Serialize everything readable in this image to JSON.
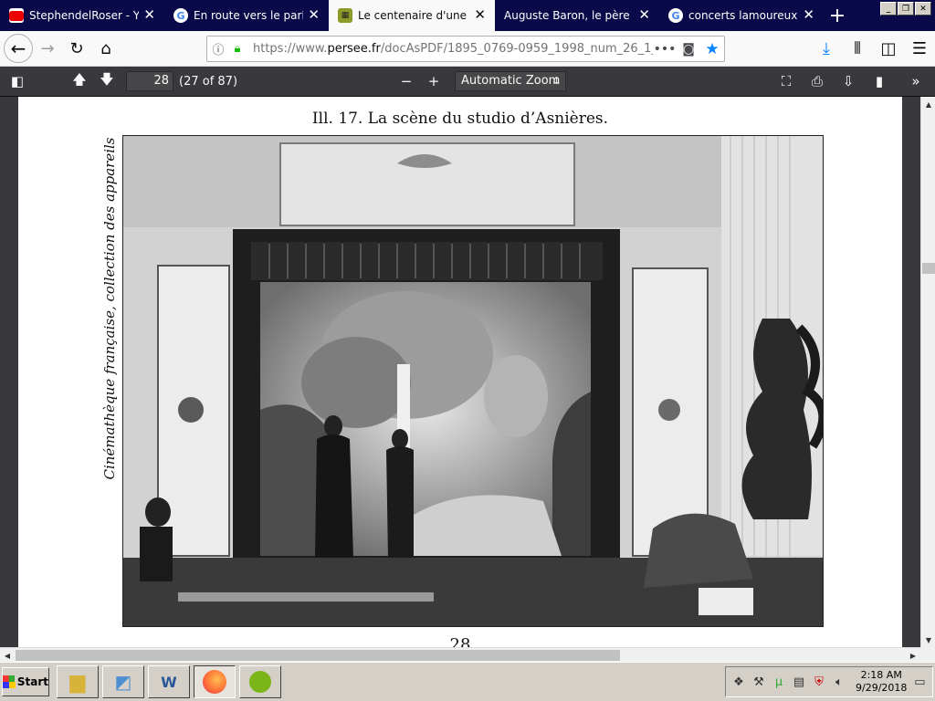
{
  "tabs": [
    {
      "label": "StephendelRoser - YouTu",
      "favicon": "youtube-icon",
      "active": false
    },
    {
      "label": "En route vers le parlant:",
      "favicon": "google-icon",
      "active": false
    },
    {
      "label": "Le centenaire d'une renc",
      "favicon": "persee-icon",
      "active": true
    },
    {
      "label": "Auguste Baron, le père du cin",
      "favicon": "",
      "active": false
    },
    {
      "label": "concerts lamoureux - Re",
      "favicon": "google-icon",
      "active": false
    }
  ],
  "tab_close_glyph": "✕",
  "new_tab_glyph": "+",
  "nav": {
    "url_prefix": "https://www.",
    "url_domain": "persee.fr",
    "url_path": "/docAsPDF/1895_0769-0959_1998_num_26_1_"
  },
  "pdf": {
    "page_number": "28",
    "page_count": "(27 of 87)",
    "zoom": "Automatic Zoom"
  },
  "document": {
    "caption": "Ill. 17. La scène du studio d’Asnières.",
    "side_credit": "Cinémathèque française, collection des appareils",
    "page_footer": "28"
  },
  "taskbar": {
    "start_label": "Start",
    "time": "2:18 AM",
    "date": "9/29/2018"
  },
  "colors": {
    "tab_strip": "#0a0a4a",
    "active_tab": "#f9f9fa",
    "pdf_toolbar": "#38383d",
    "bookmark_star": "#0a84ff",
    "secure_lock": "#12bc00"
  }
}
